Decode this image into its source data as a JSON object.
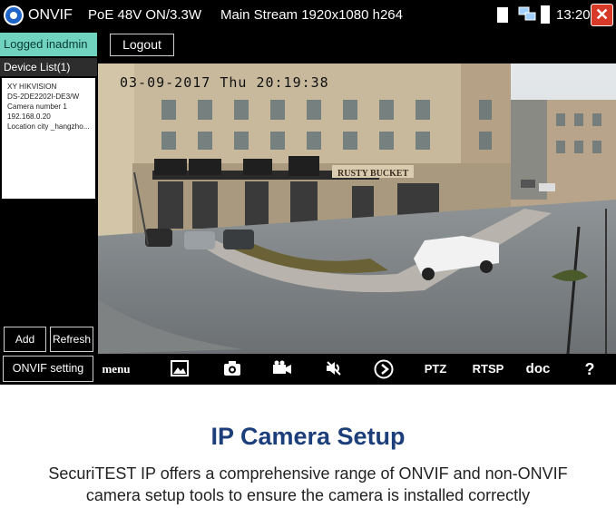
{
  "statusbar": {
    "app_name": "ONVIF",
    "poe_status": "PoE 48V ON/3.3W",
    "stream_info": "Main Stream 1920x1080 h264",
    "time": "13:20",
    "close_glyph": "✕"
  },
  "session": {
    "logged_in_label": "Logged inadmin",
    "logout_label": "Logout"
  },
  "device_list": {
    "title": "Device List(1)",
    "items": [
      {
        "vendor": "XY HIKVISION",
        "model": "DS-2DE2202I-DE3/W",
        "camera_number": "Camera number  1",
        "ip": "192.168.0.20",
        "location": "Location  city _hangzho..."
      }
    ]
  },
  "buttons": {
    "add": "Add",
    "refresh": "Refresh",
    "onvif_setting": "ONVIF setting"
  },
  "camera": {
    "osd_timestamp": "03-09-2017 Thu 20:19:38",
    "sign_text": "RUSTY BUCKET"
  },
  "toolbar": {
    "menu": "menu",
    "ptz": "PTZ",
    "rtsp": "RTSP",
    "doc": "doc",
    "help": "?",
    "icons": [
      "image-icon",
      "camera-icon",
      "video-record-icon",
      "audio-icon",
      "play-icon"
    ]
  },
  "caption": {
    "heading": "IP Camera Setup",
    "line1": "SecuriTEST IP offers a comprehensive range of ONVIF and non-ONVIF",
    "line2": "camera setup tools to ensure the camera is installed correctly"
  },
  "colors": {
    "logged_bg": "#6fd3bf",
    "close_bg": "#d83a2a",
    "heading": "#1c3e7a",
    "onvif_logo": "#1f64c8"
  }
}
